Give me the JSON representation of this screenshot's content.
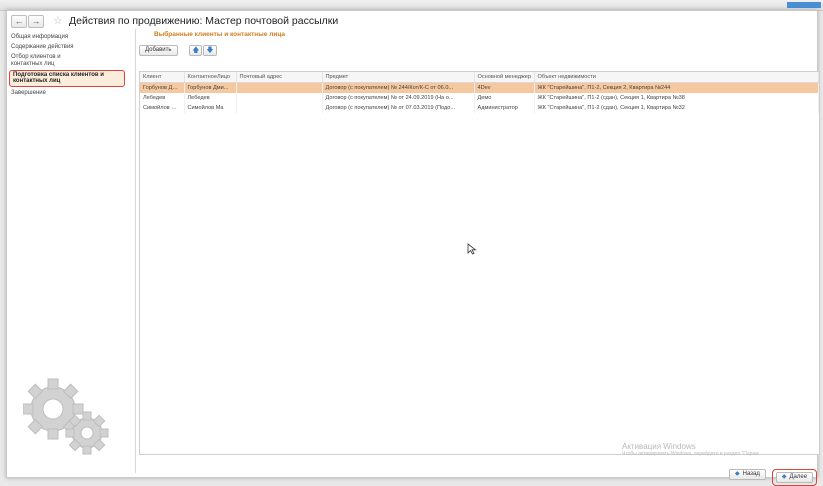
{
  "window": {
    "title": "Действия по продвижению: Мастер почтовой рассылки",
    "back_icon": "arrow-left-icon",
    "forward_icon": "arrow-right-icon",
    "favorite_icon": "star-icon"
  },
  "sidebar": {
    "items": [
      {
        "label": "Общая информация",
        "active": false
      },
      {
        "label": "Содержание действия",
        "active": false
      },
      {
        "label": "Отбор клиентов и контактных лиц",
        "active": false
      },
      {
        "label": "Подготовка списка клиентов и контактных лиц",
        "active": true
      },
      {
        "label": "Завершение",
        "active": false
      }
    ]
  },
  "main": {
    "section_title": "Выбранные клиенты и контактные лица",
    "toolbar": {
      "add_label": "Добавить",
      "move_up_icon": "arrow-up-icon",
      "move_down_icon": "arrow-down-icon"
    },
    "table": {
      "columns": [
        "Клиент",
        "КонтактноеЛицо",
        "Почтовый адрес",
        "Предмет",
        "Основной менеджер",
        "Объект недвижимости"
      ],
      "rows": [
        {
          "cells": [
            "Горбунов Дмит...",
            "Горбунов Дми...",
            "",
            "Договор (с покупателем) № 244/Кот/К-С от 06.0...",
            "4Dev",
            "ЖК \"Старейшина\", П1-2, Секция 2, Квартира №244"
          ],
          "selected": true
        },
        {
          "cells": [
            "Лебедев",
            "Лебедев",
            "",
            "Договор (с покупателем) № от 24.09.2019 (На о...",
            "Демо",
            "ЖК \"Старейшина\", П1-2 (сдан), Секция 1, Квартира №38"
          ],
          "selected": false
        },
        {
          "cells": [
            "Симойлов Мак...",
            "Симойлов Ма",
            "",
            "Договор (с покупателем) № от 07.03.2019 (Подо...",
            "Администратор",
            "ЖК \"Старейшина\", П1-2 (сдан), Секция 1, Квартира №32"
          ],
          "selected": false
        }
      ]
    }
  },
  "watermark": {
    "line1": "Активация Windows",
    "line2": "Чтобы активировать Windows, перейдите в раздел \"Парам"
  },
  "footer": {
    "back_label": "Назад",
    "next_label": "Далее"
  },
  "colors": {
    "accent_blue": "#3b7cc6",
    "selection": "#f6c8a0",
    "highlight_red": "#d9443b",
    "section_orange": "#d07d1f"
  }
}
